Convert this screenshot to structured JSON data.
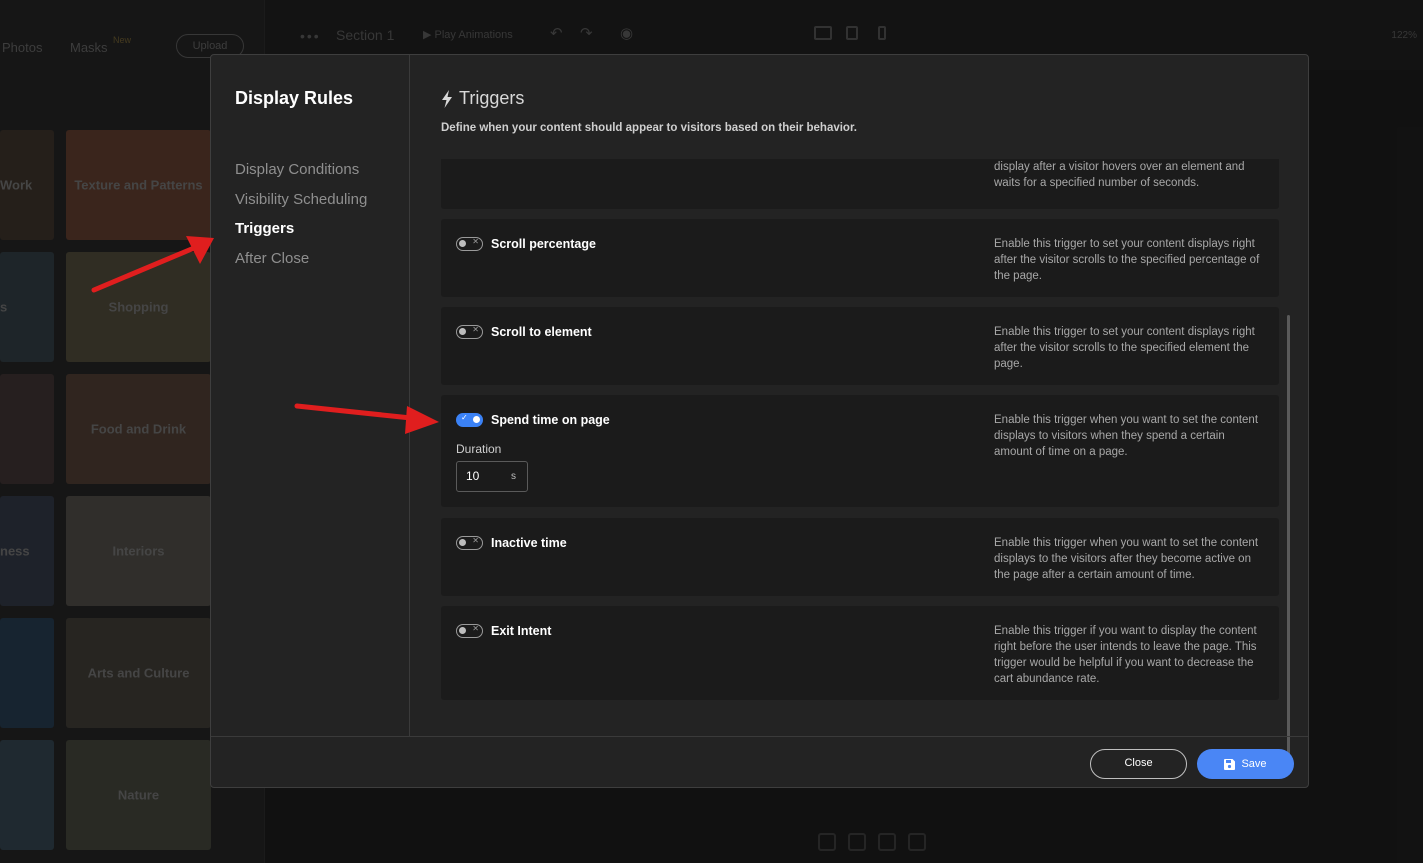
{
  "background": {
    "tabs": [
      "Photos",
      "Masks"
    ],
    "new_badge": "New",
    "upload_label": "Upload",
    "section_label": "Section 1",
    "play_label": "Play Animations",
    "zoom_label": "122%",
    "tiles": [
      {
        "label": "Work"
      },
      {
        "label": "Texture and Patterns"
      },
      {
        "label": "s"
      },
      {
        "label": "Shopping"
      },
      {
        "label": ""
      },
      {
        "label": "Food and Drink"
      },
      {
        "label": "ness"
      },
      {
        "label": "Interiors"
      },
      {
        "label": ""
      },
      {
        "label": "Arts and Culture"
      },
      {
        "label": ""
      },
      {
        "label": "Nature"
      }
    ]
  },
  "modal": {
    "title": "Display Rules",
    "nav": [
      {
        "label": "Display Conditions",
        "active": false
      },
      {
        "label": "Visibility Scheduling",
        "active": false
      },
      {
        "label": "Triggers",
        "active": true
      },
      {
        "label": "After Close",
        "active": false
      }
    ],
    "section_title": "Triggers",
    "section_icon": "lightning-icon",
    "section_subtitle": "Define when your content should appear to visitors based on their behavior.",
    "triggers": [
      {
        "name": "hover-trigger",
        "label": "",
        "enabled": false,
        "description": "display after a visitor hovers over an element and waits for a specified number of seconds."
      },
      {
        "name": "scroll-percentage",
        "label": "Scroll percentage",
        "enabled": false,
        "description": "Enable this trigger to set your content displays right after the visitor scrolls to the specified percentage of the page."
      },
      {
        "name": "scroll-to-element",
        "label": "Scroll to element",
        "enabled": false,
        "description": "Enable this trigger to set your content displays right after the visitor scrolls to the specified element the page."
      },
      {
        "name": "spend-time-on-page",
        "label": "Spend time on page",
        "enabled": true,
        "description": "Enable this trigger when you want to set the content displays to visitors when they spend a certain amount of time on a page.",
        "duration_label": "Duration",
        "duration_value": "10",
        "duration_unit": "s"
      },
      {
        "name": "inactive-time",
        "label": "Inactive time",
        "enabled": false,
        "description": "Enable this trigger when you want to set the content displays to the visitors after they become active on the page after a certain amount of time."
      },
      {
        "name": "exit-intent",
        "label": "Exit Intent",
        "enabled": false,
        "description": "Enable this trigger if you want to display the content right before the user intends to leave the page. This trigger would be helpful if you want to decrease the cart abundance rate."
      }
    ],
    "footer": {
      "close_label": "Close",
      "save_label": "Save"
    }
  },
  "colors": {
    "accent": "#4a86f5",
    "arrow": "#e01e1e"
  }
}
